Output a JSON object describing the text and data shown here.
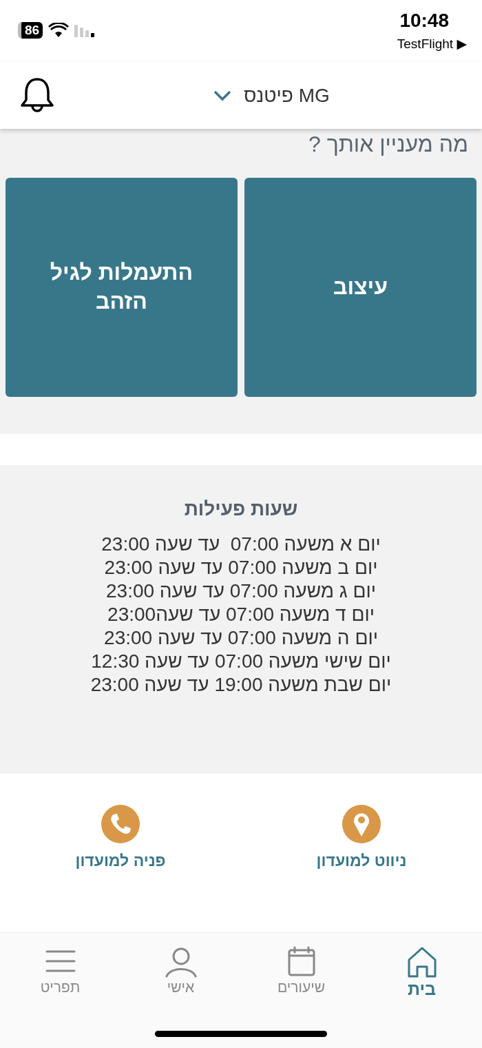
{
  "status_bar": {
    "battery": "86",
    "time": "10:48",
    "back_app": "TestFlight ▶"
  },
  "header": {
    "title": "MG פיטנס"
  },
  "interests": {
    "heading": "מה מעניין אותך ?",
    "tiles": [
      {
        "label": "עיצוב"
      },
      {
        "label": "התעמלות לגיל הזהב"
      }
    ]
  },
  "hours": {
    "title": "שעות פעילות",
    "lines": [
      "יום א משעה 07:00  עד שעה 23:00",
      "יום ב משעה 07:00 עד שעה 23:00",
      "יום ג משעה 07:00 עד שעה 23:00",
      "יום ד משעה 07:00 עד שעה23:00",
      "יום ה משעה 07:00 עד שעה 23:00",
      "יום שישי משעה 07:00 עד שעה 12:30",
      "יום שבת משעה 19:00 עד שעה 23:00"
    ]
  },
  "contacts": [
    {
      "kind": "location",
      "label": "ניווט למועדון"
    },
    {
      "kind": "phone",
      "label": "פניה למועדון"
    }
  ],
  "tab_bar": [
    {
      "kind": "home",
      "label": "בית",
      "selected": true
    },
    {
      "kind": "calendar",
      "label": "שיעורים",
      "selected": false
    },
    {
      "kind": "person",
      "label": "אישי",
      "selected": false
    },
    {
      "kind": "menu",
      "label": "תפריט",
      "selected": false
    }
  ]
}
